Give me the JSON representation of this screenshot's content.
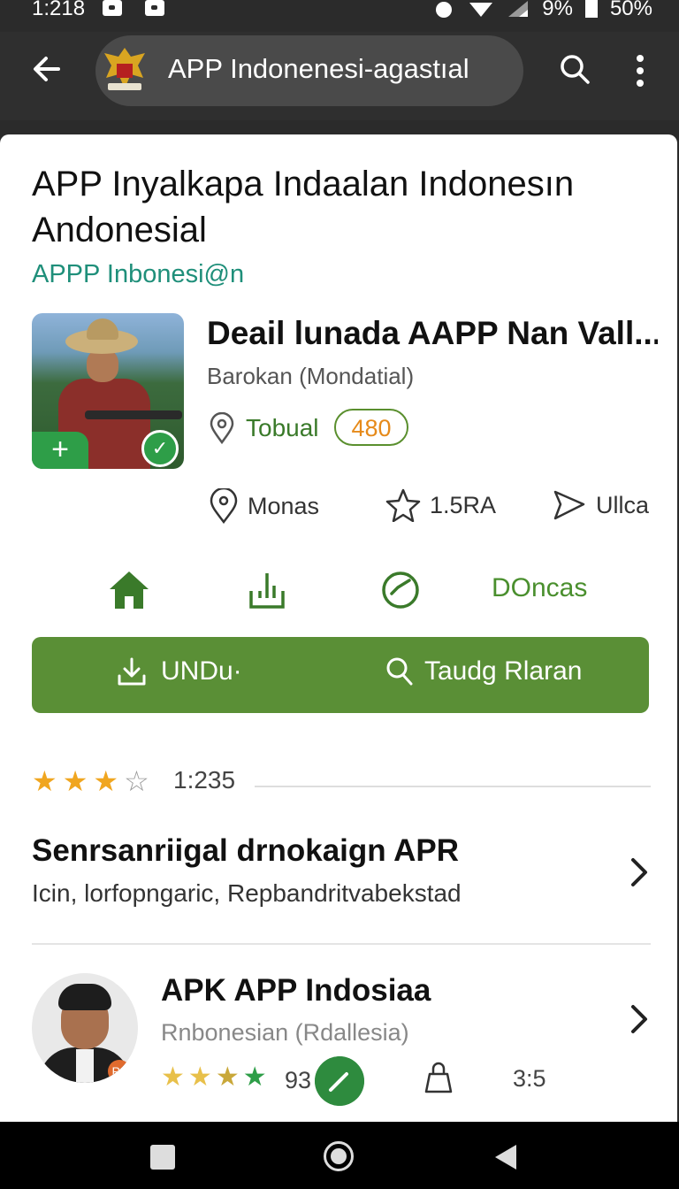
{
  "status_bar": {
    "time": "1:218",
    "battery_pct": "9%",
    "other_pct": "50%"
  },
  "app_bar": {
    "title": "APP Indonenesi-agastıal"
  },
  "header": {
    "title": "APP Inyalkapa Indaalan Indonesın Andonesial",
    "subtitle": "APPP Inbonesi@n"
  },
  "app": {
    "name": "Deail lunada AAPP Nan Vall....",
    "developer": "Barokan (Mondatial)",
    "location_label": "Tobual",
    "badge": "480",
    "meta": [
      {
        "icon": "pin-icon",
        "label": "Monas"
      },
      {
        "icon": "star-outline-icon",
        "label": "1.5RA"
      },
      {
        "icon": "share-icon",
        "label": "Ullca"
      }
    ],
    "actions_label": "DOncas"
  },
  "primary_buttons": {
    "download": "UNDu·",
    "search": "Taudg Rlaran"
  },
  "rating": {
    "value": "1:235",
    "stars_filled": 3,
    "stars_total": 4
  },
  "section": {
    "heading": "Senrsanriigal drnokaign APR",
    "description": "Icin, lorfopngaric, Repbandritvabekstad"
  },
  "related": {
    "name": "APK APP Indosiaa",
    "subtitle": "Rnbonesian (Rdallesia)",
    "avatar_tag": "P2",
    "rating_value": "93",
    "stars_filled": 4,
    "size": "3:5"
  },
  "colors": {
    "accent_green": "#5a8f36",
    "teal": "#1f8f7a",
    "badge_orange": "#e68a1a",
    "star_gold": "#f0a620"
  }
}
